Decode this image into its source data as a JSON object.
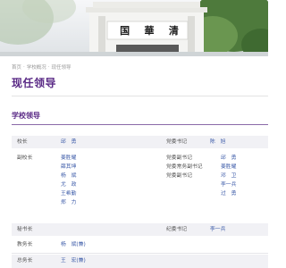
{
  "banner": {
    "gate_inscription": [
      "国",
      "華",
      "清"
    ]
  },
  "breadcrumb": {
    "items": [
      "首页",
      "学校概况",
      "现任领导"
    ],
    "separator": "·"
  },
  "page_title": "现任领导",
  "section_title": "学校领导",
  "colors": {
    "accent": "#5a2a86",
    "link": "#3b5aa8",
    "shaded_row": "#f1f1f5"
  },
  "rows": [
    {
      "left_title": "校长",
      "left_names": [
        "邱　勇"
      ],
      "right_titles": [
        "党委书记"
      ],
      "right_names": [
        "陈　旭"
      ]
    },
    {
      "left_title": "副校长",
      "left_names": [
        "姜胜耀",
        "薛其坤",
        "杨　斌",
        "尤　政",
        "王希勤",
        "郑　力"
      ],
      "left_names_display": [
        "姜胜耀",
        "薛其坤",
        "杨　斌",
        "尤　政",
        "王希勤",
        "郑　力"
      ],
      "right_titles": [
        "党委副书记",
        "党委常务副书记",
        "党委副书记"
      ],
      "right_names": [
        "邱　勇",
        "姜胜耀",
        "邓　卫",
        "李一兵",
        "过　勇"
      ]
    },
    {
      "left_title": "秘书长",
      "left_names": [],
      "right_titles": [
        "纪委书记"
      ],
      "right_names": [
        "李一兵"
      ]
    },
    {
      "left_title": "教务长",
      "left_names": [
        "杨　斌(兼)"
      ],
      "right_titles": [],
      "right_names": []
    },
    {
      "left_title": "总务长",
      "left_names": [
        "王　宏(兼)"
      ],
      "right_titles": [],
      "right_names": []
    }
  ]
}
